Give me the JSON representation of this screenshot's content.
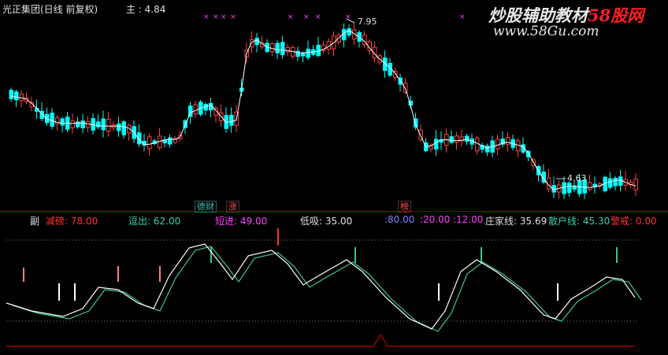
{
  "header": {
    "stock_title": "光正集团(日线 前复权)",
    "main_label": "主 : 4.84",
    "high_annotation": "7.95",
    "low_annotation": "4.63"
  },
  "watermark": {
    "line1_a": "炒股辅助教材",
    "line1_b": "58股网",
    "line2": "www.58Gu.com"
  },
  "event_tags": [
    {
      "text": "德财",
      "color": "#40c0c0"
    },
    {
      "text": "涨",
      "color": "#ff5050"
    },
    {
      "text": "榜",
      "color": "#ff5050"
    }
  ],
  "indicator": {
    "prefix": "副",
    "items": [
      {
        "label": "减磅:",
        "value": "78.00",
        "color": "#ff3030"
      },
      {
        "label": "逗出:",
        "value": "62.00",
        "color": "#40d0b0"
      },
      {
        "label": "短进:",
        "value": "49.00",
        "color": "#ff40ff"
      },
      {
        "label": "低吸:",
        "value": "35.00",
        "color": "#e0e0e0"
      },
      {
        "label": ":",
        "value": "80.00",
        "color": "#8080ff"
      },
      {
        "label": ":",
        "value": "20.00",
        "color": "#ff40ff"
      },
      {
        "label": ":",
        "value": "12.00",
        "color": "#ff40ff"
      },
      {
        "label": "庄家线:",
        "value": "35.69",
        "color": "#e0e0e0"
      },
      {
        "label": "散户线:",
        "value": "45.30",
        "color": "#40d0b0"
      },
      {
        "label": "警戒:",
        "value": "0.00",
        "color": "#ff3030"
      }
    ]
  },
  "colors": {
    "up": "#ff4040",
    "down": "#00ffff",
    "ma": "#ffffff",
    "fast_line": "#ffffff",
    "slow_line": "#40c0a0",
    "baseline": "#c00000"
  }
}
